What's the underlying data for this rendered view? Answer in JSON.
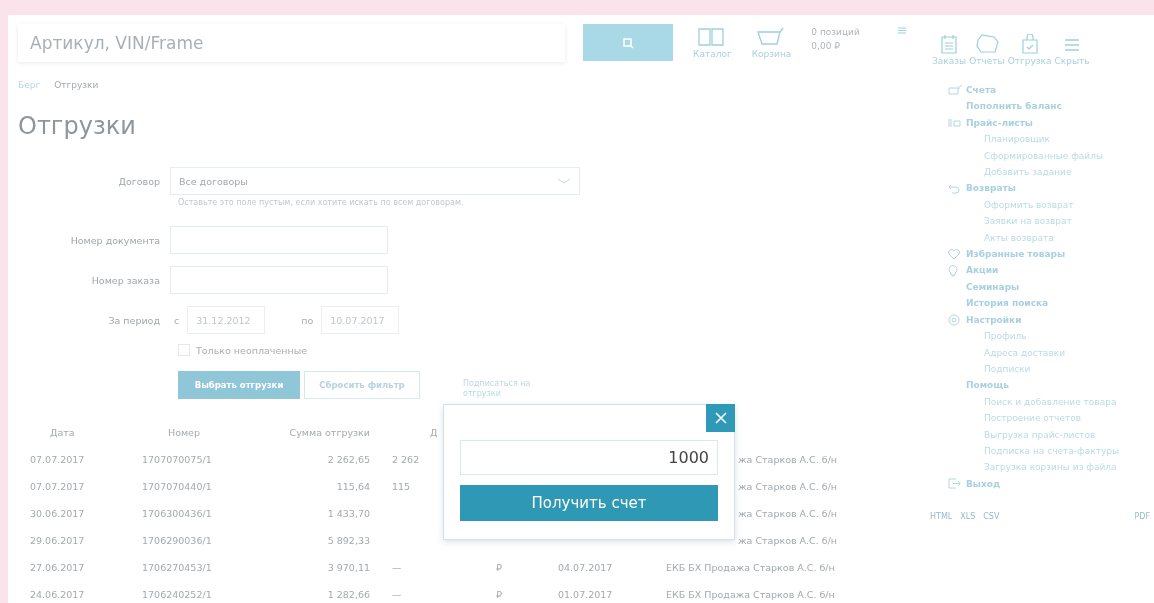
{
  "header": {
    "search": {
      "placeholder": "Артикул, VIN/Frame"
    },
    "nav_left": [
      {
        "label": "Каталог"
      },
      {
        "label": "Корзина"
      }
    ],
    "cart_summary": {
      "count": "0 позиций",
      "total": "0,00 ₽"
    },
    "nav_right": [
      {
        "label": "Заказы"
      },
      {
        "label": "Отчеты"
      },
      {
        "label": "Отгрузка"
      },
      {
        "label": "Скрыть"
      }
    ]
  },
  "breadcrumbs": [
    {
      "label": "Берг",
      "kind": "link"
    },
    {
      "label": "Отгрузки",
      "kind": "current"
    }
  ],
  "page_title": "Отгрузки",
  "form": {
    "contract": {
      "label": "Договор",
      "value": "Все договоры",
      "hint": "Оставьте это поле пустым, если хотите искать по всем договорам."
    },
    "doc_number": {
      "label": "Номер документа"
    },
    "order_number": {
      "label": "Номер заказа"
    },
    "period": {
      "label": "За период",
      "from_label": "с",
      "from": "31.12.2012",
      "to_label": "по",
      "to": "10.07.2017"
    },
    "unpaid_only": {
      "label": "Только неоплаченные",
      "checked": false
    },
    "buttons": [
      {
        "label": "Выбрать отгрузки",
        "kind": "primary"
      },
      {
        "label": "Сбросить фильтр",
        "kind": "secondary"
      }
    ],
    "subscribe_link": "Подписаться на отгрузки"
  },
  "table": {
    "columns": [
      "Дата",
      "Номер",
      "Сумма отгрузки",
      "Д"
    ],
    "rows": [
      {
        "kind": "covered",
        "date": "07.07.2017",
        "number": "1707070075/1",
        "sum": "2 262,65",
        "column_4": "2 262",
        "column_7": "жа Старков А.С. б/н"
      },
      {
        "kind": "covered",
        "date": "07.07.2017",
        "number": "1707070440/1",
        "sum": "115,64",
        "column_4": "115",
        "column_7": "жа Старков А.С. б/н"
      },
      {
        "kind": "covered",
        "date": "30.06.2017",
        "number": "1706300436/1",
        "sum": "1 433,70",
        "column_7": "жа Старков А.С. б/н"
      },
      {
        "kind": "covered",
        "date": "29.06.2017",
        "number": "1706290036/1",
        "sum": "5 892,33",
        "column_7": "жа Старков А.С. б/н"
      },
      {
        "kind": "full",
        "date": "27.06.2017",
        "number": "1706270453/1",
        "sum": "3 970,11",
        "column_4": "—",
        "column_5": "₽",
        "column_6": "04.07.2017",
        "column_7": "ЕКБ БХ Продажа Старков А.С. б/н"
      },
      {
        "kind": "full",
        "date": "24.06.2017",
        "number": "1706240252/1",
        "sum": "1 282,66",
        "column_4": "—",
        "column_5": "₽",
        "column_6": "01.07.2017",
        "column_7": "ЕКБ БХ Продажа Старков А.С. б/н"
      }
    ]
  },
  "sidebar": {
    "items": [
      {
        "label": "Счета",
        "children": [
          {
            "label": "Пополнить баланс",
            "kind": "bold"
          }
        ]
      },
      {
        "label": "Прайс-листы",
        "children": [
          {
            "label": "Планировщик",
            "kind": "plain"
          },
          {
            "label": "Сформированные файлы",
            "kind": "plain"
          },
          {
            "label": "Добавить задание",
            "kind": "plain"
          }
        ]
      },
      {
        "label": "Возвраты",
        "children": [
          {
            "label": "Оформить возврат",
            "kind": "plain"
          },
          {
            "label": "Заявки на возврат",
            "kind": "plain"
          },
          {
            "label": "Акты возврата",
            "kind": "plain"
          }
        ]
      },
      {
        "label": "Избранные товары"
      },
      {
        "label": "Акции"
      },
      {
        "label": "Семинары"
      },
      {
        "label": "История поиска"
      },
      {
        "label": "Настройки",
        "children": [
          {
            "label": "Профиль",
            "kind": "plain"
          },
          {
            "label": "Адреса доставки",
            "kind": "plain"
          },
          {
            "label": "Подписки",
            "kind": "plain"
          }
        ]
      },
      {
        "label": "Помощь",
        "children": [
          {
            "label": "Поиск и добавление товара",
            "kind": "plain"
          },
          {
            "label": "Построение отчетов",
            "kind": "plain"
          },
          {
            "label": "Выгрузка прайс-листов",
            "kind": "plain"
          },
          {
            "label": "Подписка на счета-фактуры",
            "kind": "plain"
          },
          {
            "label": "Загрузка корзины из файла",
            "kind": "plain"
          }
        ]
      },
      {
        "label": "Выход"
      }
    ],
    "export_links": [
      "HTML",
      "XLS",
      "CSV"
    ],
    "pdf_link": "PDF"
  },
  "modal": {
    "amount": "1000",
    "button": "Получить счет"
  }
}
